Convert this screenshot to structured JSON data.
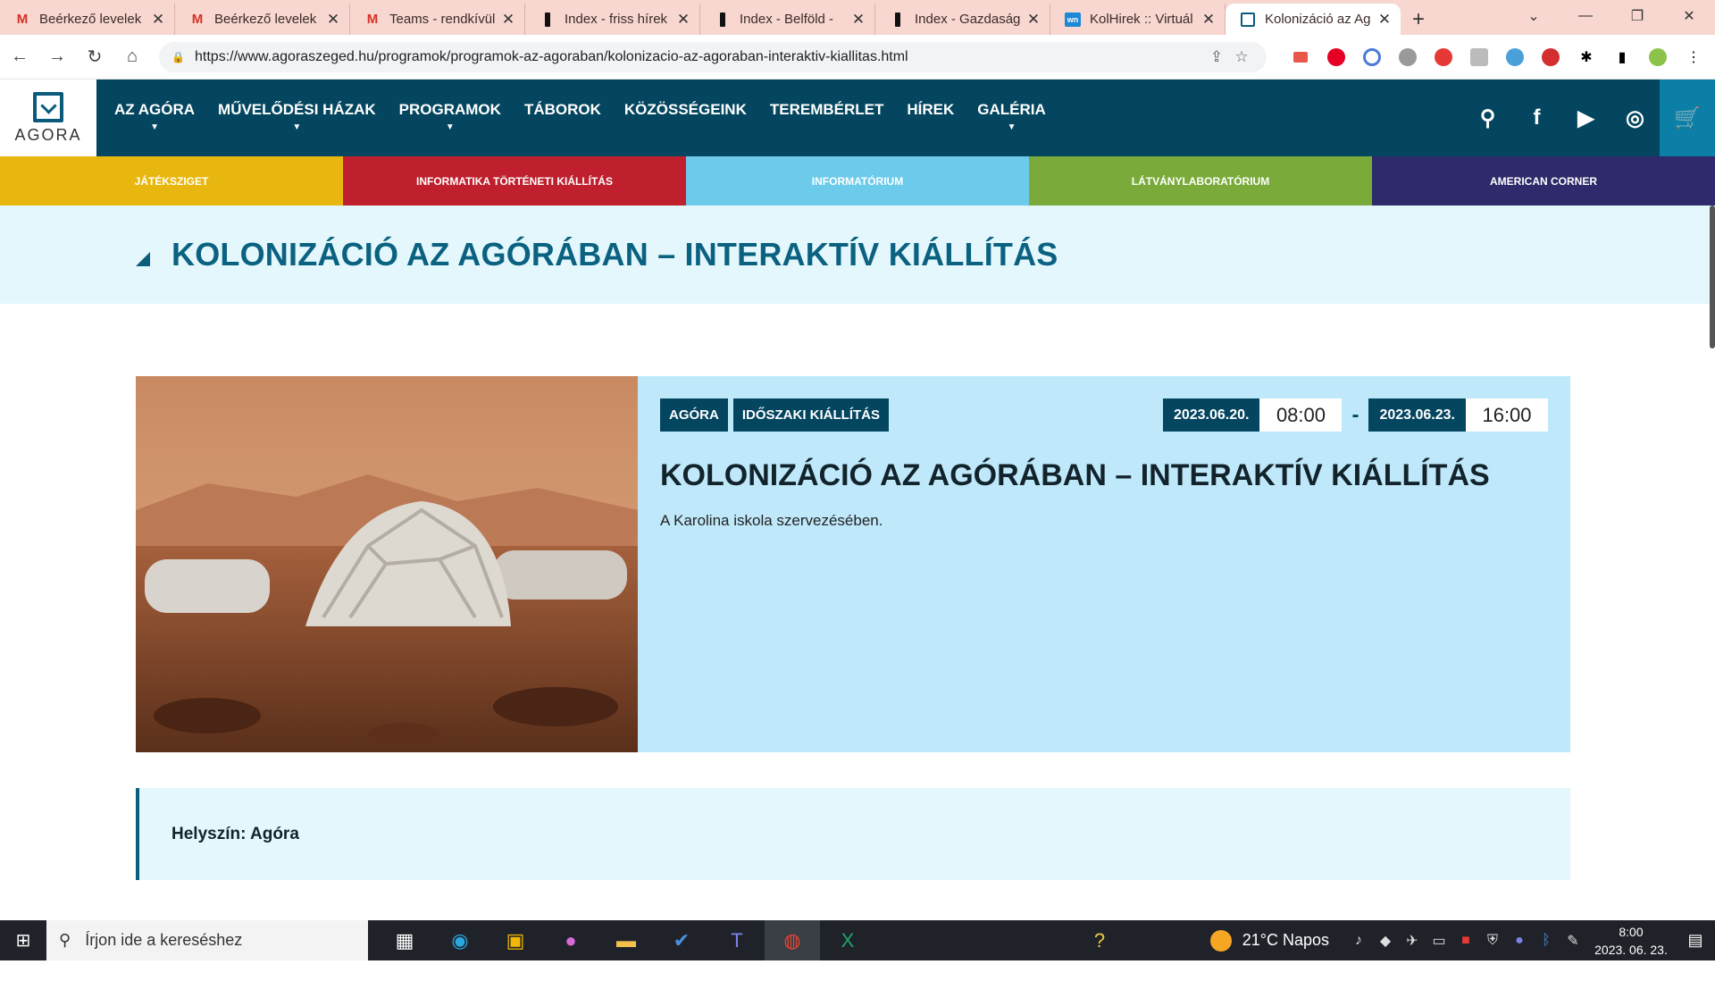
{
  "tabs": [
    {
      "title": "Beérkező levelek",
      "icon": "gmail-icon",
      "active": false
    },
    {
      "title": "Beérkező levelek",
      "icon": "gmail-icon",
      "active": false
    },
    {
      "title": "Teams - rendkívül",
      "icon": "gmail-icon",
      "active": false
    },
    {
      "title": "Index - friss hírek",
      "icon": "index-icon",
      "active": false
    },
    {
      "title": "Index - Belföld - ",
      "icon": "index-icon",
      "active": false
    },
    {
      "title": "Index - Gazdaság",
      "icon": "index-icon",
      "active": false
    },
    {
      "title": "KolHirek :: Virtuál",
      "icon": "kolhirek-icon",
      "active": false
    },
    {
      "title": "Kolonizáció az Ag",
      "icon": "agora-icon",
      "active": true
    }
  ],
  "browser": {
    "url": "https://www.agoraszeged.hu/programok/programok-az-agoraban/kolonizacio-az-agoraban-interaktiv-kiallitas.html"
  },
  "site": {
    "logo_text": "AGORA",
    "menu": [
      {
        "label": "AZ AGÓRA",
        "dropdown": true
      },
      {
        "label": "MŰVELŐDÉSI HÁZAK",
        "dropdown": true
      },
      {
        "label": "PROGRAMOK",
        "dropdown": true
      },
      {
        "label": "TÁBOROK",
        "dropdown": false
      },
      {
        "label": "KÖZÖSSÉGEINK",
        "dropdown": false
      },
      {
        "label": "TEREMBÉRLET",
        "dropdown": false
      },
      {
        "label": "HÍREK",
        "dropdown": false
      },
      {
        "label": "GALÉRIA",
        "dropdown": true
      }
    ],
    "strip": [
      {
        "label": "JÁTÉKSZIGET",
        "color": "#e8b70f"
      },
      {
        "label": "INFORMATIKA TÖRTÉNETI KIÁLLÍTÁS",
        "color": "#c0202e"
      },
      {
        "label": "INFORMATÓRIUM",
        "color": "#6ccbea"
      },
      {
        "label": "LÁTVÁNYLABORATÓRIUM",
        "color": "#7aab3a"
      },
      {
        "label": "AMERICAN CORNER",
        "color": "#2e2a6b"
      }
    ],
    "page_title": "KOLONIZÁCIÓ AZ AGÓRÁBAN – INTERAKTÍV KIÁLLÍTÁS",
    "event": {
      "tags": [
        "AGÓRA",
        "IDŐSZAKI KIÁLLÍTÁS"
      ],
      "start_date": "2023.06.20.",
      "start_time": "08:00",
      "end_date": "2023.06.23.",
      "end_time": "16:00",
      "title": "KOLONIZÁCIÓ AZ AGÓRÁBAN – INTERAKTÍV KIÁLLÍTÁS",
      "description": "A Karolina iskola szervezésében."
    },
    "location": "Helyszín: Agóra"
  },
  "taskbar": {
    "search_placeholder": "Írjon ide a kereséshez",
    "weather": "21°C  Napos",
    "time": "8:00",
    "date": "2023. 06. 23."
  }
}
